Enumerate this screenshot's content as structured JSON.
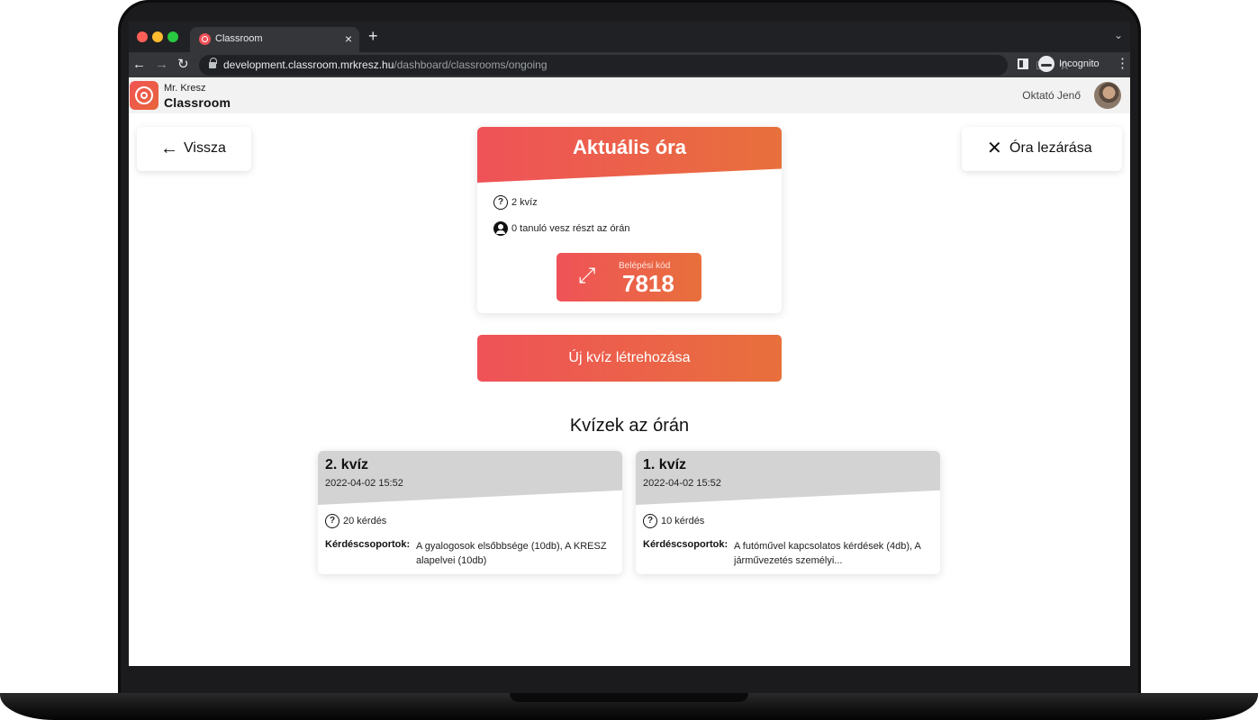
{
  "browser": {
    "tab_title": "Classroom",
    "tab_close": "×",
    "new_tab": "+",
    "url_host": "development.classroom.mrkresz.hu",
    "url_path": "/dashboard/classrooms/ongoing",
    "incognito_label": "Incognito"
  },
  "header": {
    "brand_top": "Mr. Kresz",
    "brand_main": "Classroom",
    "user_name": "Oktató Jenő"
  },
  "actions": {
    "back_label": "Vissza",
    "close_label": "Óra lezárása"
  },
  "lesson": {
    "title": "Aktuális óra",
    "quiz_count": "2 kvíz",
    "students": "0 tanuló vesz részt az órán",
    "code_label": "Belépési kód",
    "code_value": "7818"
  },
  "new_quiz_label": "Új kvíz létrehozása",
  "quizzes_title": "Kvízek az órán",
  "quizzes": [
    {
      "title": "2. kvíz",
      "date": "2022-04-02 15:52",
      "count": "20 kérdés",
      "groups_label": "Kérdéscsoportok:",
      "groups": "A gyalogosok elsőbbsége (10db), A KRESZ alapelvei (10db)"
    },
    {
      "title": "1. kvíz",
      "date": "2022-04-02 15:52",
      "count": "10 kérdés",
      "groups_label": "Kérdéscsoportok:",
      "groups": "A futóművel kapcsolatos kérdések (4db), A járművezetés személyi..."
    }
  ],
  "colors": {
    "accent_start": "#ef5258",
    "accent_end": "#e8703c",
    "quiz_header": "#d3d3d3"
  }
}
